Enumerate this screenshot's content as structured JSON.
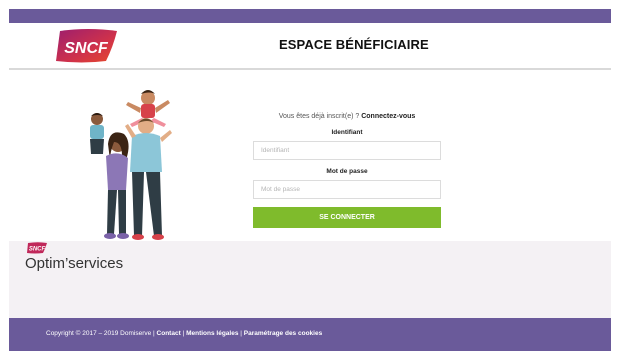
{
  "header": {
    "logo_text": "SNCF",
    "title": "ESPACE BÉNÉFICIAIRE"
  },
  "login": {
    "already_registered": "Vous êtes déjà inscrit(e) ?",
    "connect_link": "Connectez-vous",
    "identifiant_label": "Identifiant",
    "identifiant_placeholder": "Identifiant",
    "password_label": "Mot de passe",
    "password_placeholder": "Mot de passe",
    "submit_label": "SE CONNECTER"
  },
  "brand": {
    "mini_logo_text": "SNCF",
    "name": "Optim’services"
  },
  "footer": {
    "copyright": "Copyright © 2017 – 2019 Domiserve |",
    "contact": "Contact",
    "sep1": "|",
    "legal": "Mentions légales",
    "sep2": "|",
    "cookies": "Paramétrage des cookies"
  },
  "colors": {
    "header_bar": "#6a5a9a",
    "button": "#7fbb2c",
    "brand_bg": "#f4f1f4",
    "logo_gradient_start": "#b01f6b",
    "logo_gradient_end": "#e2452e"
  },
  "illustration": "family-illustration"
}
